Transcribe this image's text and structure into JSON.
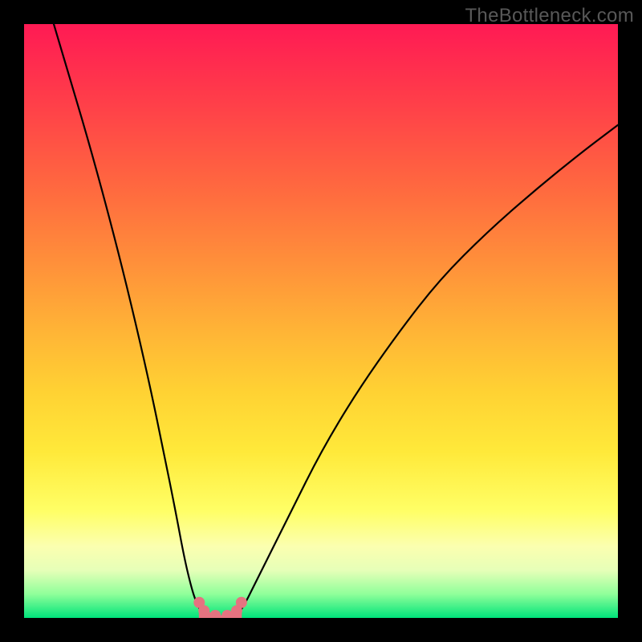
{
  "watermark": "TheBottleneck.com",
  "chart_data": {
    "type": "line",
    "title": "",
    "xlabel": "",
    "ylabel": "",
    "xlim": [
      0,
      100
    ],
    "ylim": [
      0,
      100
    ],
    "series": [
      {
        "name": "left-branch",
        "x": [
          5,
          8,
          11.5,
          15,
          18,
          21,
          23.5,
          25.5,
          27,
          28.2,
          29,
          29.7,
          30.3
        ],
        "y": [
          100,
          90,
          78,
          65,
          53,
          40,
          28,
          18,
          10,
          5,
          2.6,
          1.2,
          0.5
        ]
      },
      {
        "name": "right-branch",
        "x": [
          36,
          37,
          38.5,
          41,
          45,
          50,
          56,
          63,
          70,
          78,
          86,
          94,
          100
        ],
        "y": [
          0.5,
          2,
          5,
          10,
          18,
          28,
          38,
          48,
          57,
          65,
          72,
          78.5,
          83
        ]
      }
    ],
    "markers": {
      "name": "trough-dots",
      "x": [
        29.5,
        30.3,
        32.2,
        34.2,
        35.8,
        36.6
      ],
      "y": [
        2.6,
        1.2,
        0.4,
        0.4,
        1.2,
        2.6
      ]
    },
    "trough_band": {
      "x": [
        29.5,
        30.6,
        32.0,
        33.3,
        34.6,
        35.8,
        36.6,
        36.6,
        35.8,
        34.6,
        33.3,
        32.0,
        30.6,
        29.5
      ],
      "y": [
        2.6,
        1.2,
        0.55,
        0.35,
        0.55,
        1.2,
        2.6,
        0.0,
        0.0,
        0.0,
        0.0,
        0.0,
        0.0,
        0.0
      ]
    },
    "grid": false,
    "legend": false
  }
}
